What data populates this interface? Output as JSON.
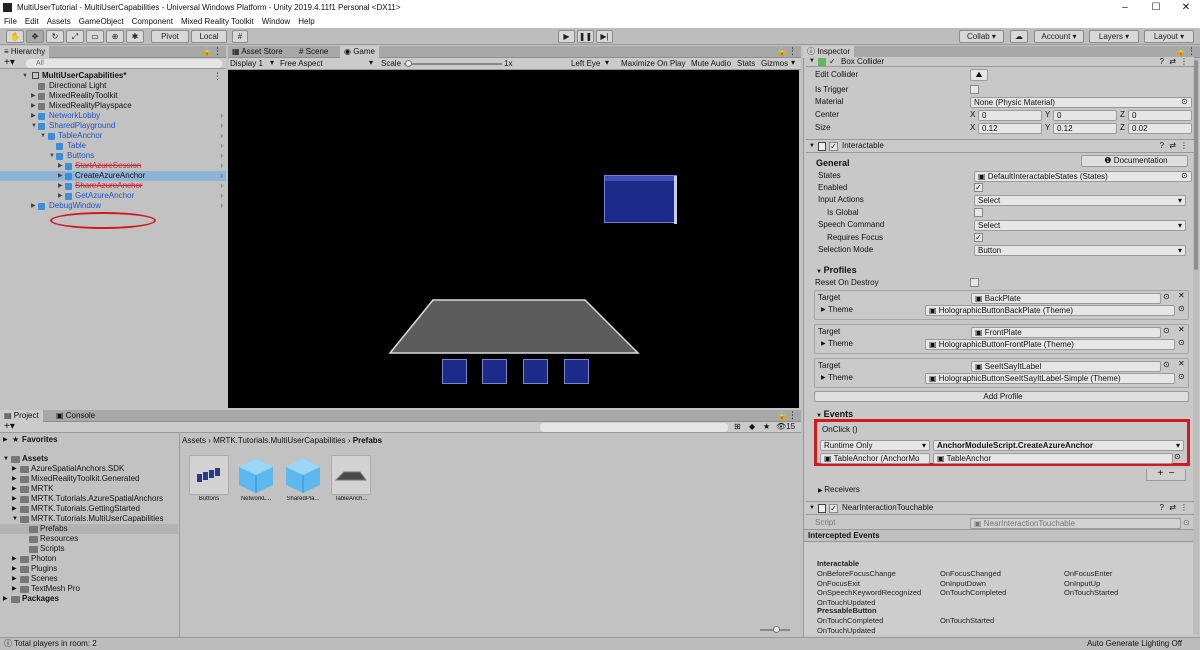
{
  "window": {
    "title": "MultiUserTutorial - MultiUserCapabilities - Universal Windows Platform - Unity 2019.4.11f1 Personal <DX11>",
    "controls": [
      "–",
      "☐",
      "✕"
    ]
  },
  "menu": [
    "File",
    "Edit",
    "Assets",
    "GameObject",
    "Component",
    "Mixed Reality Toolkit",
    "Window",
    "Help"
  ],
  "toolbar": {
    "pivot": "Pivot",
    "local": "Local",
    "collab": "Collab ▾",
    "account": "Account ▾",
    "layers": "Layers ▾",
    "layout": "Layout ▾"
  },
  "hierarchy": {
    "tab": "Hierarchy",
    "search_placeholder": "All",
    "scene": "MultiUserCapabilities*",
    "items": [
      {
        "label": "Directional Light"
      },
      {
        "label": "MixedRealityToolkit"
      },
      {
        "label": "MixedRealityPlayspace"
      },
      {
        "label": "NetworkLobby"
      },
      {
        "label": "SharedPlayground"
      },
      {
        "label": "TableAnchor"
      },
      {
        "label": "Table"
      },
      {
        "label": "Buttons"
      },
      {
        "label": "StartAzureSession"
      },
      {
        "label": "CreateAzureAnchor"
      },
      {
        "label": "ShareAzureAnchor"
      },
      {
        "label": "GetAzureAnchor"
      },
      {
        "label": "DebugWindow"
      }
    ]
  },
  "game_tabs": {
    "asset_store": "Asset Store",
    "scene": "Scene",
    "game": "Game"
  },
  "game_bar": {
    "display": "Display 1",
    "aspect": "Free Aspect",
    "scale_label": "Scale",
    "scale_value": "1x",
    "left_eye": "Left Eye",
    "maximize": "Maximize On Play",
    "mute": "Mute Audio",
    "stats": "Stats",
    "gizmos": "Gizmos"
  },
  "project": {
    "tab": "Project",
    "console_tab": "Console",
    "count": "15",
    "favorites": "Favorites",
    "assets": "Assets",
    "folders": [
      "AzureSpatialAnchors.SDK",
      "MixedRealityToolkit.Generated",
      "MRTK",
      "MRTK.Tutorials.AzureSpatialAnchors",
      "MRTK.Tutorials.GettingStarted",
      "MRTK.Tutorials.MultiUserCapabilities",
      "Prefabs",
      "Resources",
      "Scripts",
      "Photon",
      "Plugins",
      "Scenes",
      "TextMesh Pro"
    ],
    "packages": "Packages",
    "breadcrumb": [
      "Assets",
      "MRTK.Tutorials.MultiUserCapabilities",
      "Prefabs"
    ],
    "items": [
      "Buttons",
      "NetworkL...",
      "SharedPla...",
      "TableAnch..."
    ]
  },
  "status": {
    "left": "Total players in room: 2",
    "right": "Auto Generate Lighting Off"
  },
  "inspector": {
    "tab": "Inspector",
    "box_collider": {
      "title": "Box Collider",
      "edit_collider": "Edit Collider",
      "is_trigger": "Is Trigger",
      "material_label": "Material",
      "material_value": "None (Physic Material)",
      "center_label": "Center",
      "size_label": "Size",
      "center": {
        "x": "0",
        "y": "0",
        "z": "0"
      },
      "size": {
        "x": "0.12",
        "y": "0.12",
        "z": "0.02"
      }
    },
    "interactable": {
      "title": "Interactable",
      "general": "General",
      "documentation": "Documentation",
      "states_label": "States",
      "states_value": "DefaultInteractableStates (States)",
      "enabled": "Enabled",
      "input_actions_label": "Input Actions",
      "input_actions_value": "Select",
      "is_global": "Is Global",
      "speech_label": "Speech Command",
      "speech_value": "Select",
      "requires_focus": "Requires Focus",
      "selection_mode_label": "Selection Mode",
      "selection_mode_value": "Button",
      "profiles": "Profiles",
      "reset_on_destroy": "Reset On Destroy",
      "profile_list": [
        {
          "target": "BackPlate",
          "theme": "HolographicButtonBackPlate (Theme)"
        },
        {
          "target": "FrontPlate",
          "theme": "HolographicButtonFrontPlate (Theme)"
        },
        {
          "target": "SeeItSayItLabel",
          "theme": "HolographicButtonSeeItSayItLabel-Simple (Theme)"
        }
      ],
      "target_label": "Target",
      "theme_label": "Theme",
      "add_profile": "Add Profile",
      "events": "Events",
      "onclick": "OnClick ()",
      "runtime": "Runtime Only",
      "function": "AnchorModuleScript.CreateAzureAnchor",
      "object": "TableAnchor (AnchorMo",
      "argument": "TableAnchor",
      "receivers": "Receivers"
    },
    "near": {
      "title": "NearInteractionTouchable",
      "script_label": "Script",
      "script_value": "NearInteractionTouchable"
    },
    "intercepted": "Intercepted Events",
    "events": {
      "interactable_header": "Interactable",
      "col1": [
        "OnBeforeFocusChange",
        "OnFocusExit",
        "OnSpeechKeywordRecognized",
        "OnTouchUpdated"
      ],
      "col2": [
        "OnFocusChanged",
        "OnInputDown",
        "OnTouchCompleted"
      ],
      "col3": [
        "OnFocusEnter",
        "OnInputUp",
        "OnTouchStarted"
      ],
      "pressable_header": "PressableButton",
      "p_col1": [
        "OnTouchCompleted",
        "OnTouchUpdated"
      ],
      "p_col2": [
        "OnTouchStarted"
      ]
    }
  },
  "colors": {
    "highlight": "#d4181f",
    "selection": "#8fb4d8",
    "link": "#1f55c5",
    "hologram": "#1c2a8a"
  }
}
